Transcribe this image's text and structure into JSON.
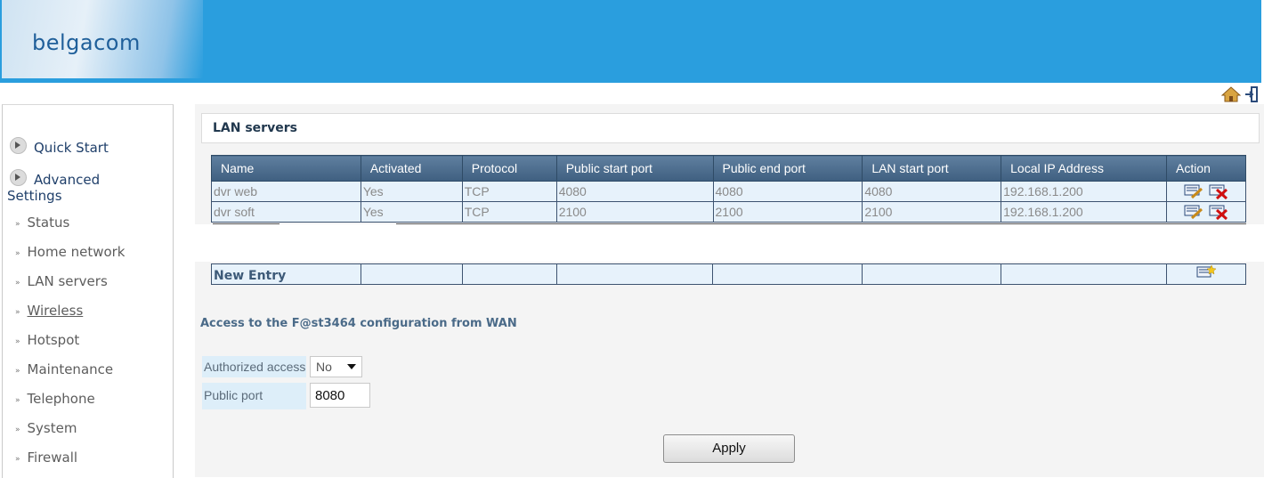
{
  "brand": {
    "logo_text": "belgacom"
  },
  "top_icons": {
    "home": "home-icon",
    "logout": "logout-icon"
  },
  "sidebar": {
    "main_items": [
      {
        "label": "Quick Start",
        "icon": "arrow-circle-icon"
      },
      {
        "label": "Advanced Settings",
        "icon": "arrow-circle-icon"
      }
    ],
    "items": [
      {
        "label": "Status"
      },
      {
        "label": "Home network"
      },
      {
        "label": "LAN servers"
      },
      {
        "label": "Wireless"
      },
      {
        "label": "Hotspot"
      },
      {
        "label": "Maintenance"
      },
      {
        "label": "Telephone"
      },
      {
        "label": "System"
      },
      {
        "label": "Firewall"
      }
    ]
  },
  "page": {
    "title": "LAN servers"
  },
  "servers_table": {
    "headers": [
      "Name",
      "Activated",
      "Protocol",
      "Public start port",
      "Public end port",
      "LAN start port",
      "Local IP Address",
      "Action"
    ],
    "rows": [
      {
        "name": "dvr web",
        "activated": "Yes",
        "protocol": "TCP",
        "public_start": "4080",
        "public_end": "4080",
        "lan_start": "4080",
        "local_ip": "192.168.1.200"
      },
      {
        "name": "dvr soft",
        "activated": "Yes",
        "protocol": "TCP",
        "public_start": "2100",
        "public_end": "2100",
        "lan_start": "2100",
        "local_ip": "192.168.1.200"
      }
    ],
    "new_entry_label": "New Entry"
  },
  "wan_access": {
    "title": "Access to the F@st3464 configuration from WAN",
    "authorized_label": "Authorized access",
    "authorized_value": "No",
    "public_port_label": "Public port",
    "public_port_value": "8080"
  },
  "apply_label": "Apply",
  "colors": {
    "header_bg": "#2a9ede",
    "table_header": "#4a6a8a",
    "row_bg": "#e7f2fb"
  }
}
